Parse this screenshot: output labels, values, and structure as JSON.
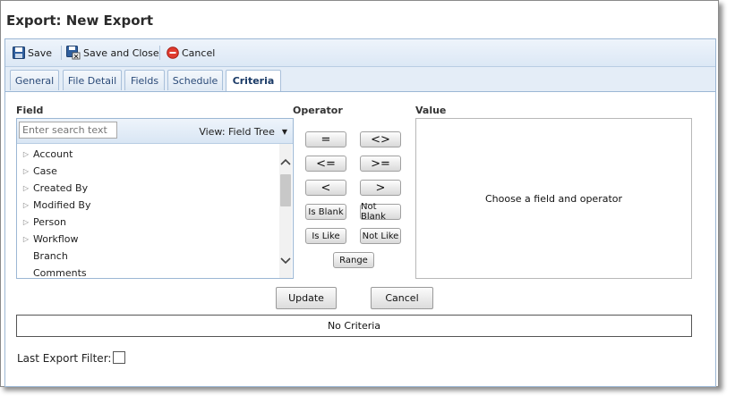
{
  "window": {
    "title": "Export: New Export"
  },
  "toolbar": {
    "save_label": "Save",
    "save_close_label": "Save and Close",
    "cancel_label": "Cancel"
  },
  "tabs": [
    {
      "label": "General"
    },
    {
      "label": "File Detail"
    },
    {
      "label": "Fields"
    },
    {
      "label": "Schedule"
    },
    {
      "label": "Criteria",
      "active": true
    }
  ],
  "field_panel": {
    "heading": "Field",
    "search_placeholder": "Enter search text",
    "view_label": "View: Field Tree",
    "items": [
      {
        "label": "Account",
        "expandable": true
      },
      {
        "label": "Case",
        "expandable": true
      },
      {
        "label": "Created By",
        "expandable": true
      },
      {
        "label": "Modified By",
        "expandable": true
      },
      {
        "label": "Person",
        "expandable": true
      },
      {
        "label": "Workflow",
        "expandable": true
      },
      {
        "label": "Branch",
        "expandable": false
      },
      {
        "label": "Comments",
        "expandable": false
      }
    ]
  },
  "operator_panel": {
    "heading": "Operator",
    "buttons": [
      "=",
      "<>",
      "<=",
      ">=",
      "<",
      ">",
      "Is Blank",
      "Not Blank",
      "Is Like",
      "Not Like",
      "Range"
    ]
  },
  "value_panel": {
    "heading": "Value",
    "placeholder_text": "Choose a field and operator"
  },
  "actions": {
    "update_label": "Update",
    "cancel_label": "Cancel"
  },
  "criteria": {
    "summary": "No Criteria"
  },
  "last_export_filter": {
    "label": "Last Export Filter:",
    "checked": false
  },
  "colors": {
    "accent": "#2a4a78",
    "border": "#9cb7d4",
    "toolbar_bg": "#dce8f5"
  }
}
